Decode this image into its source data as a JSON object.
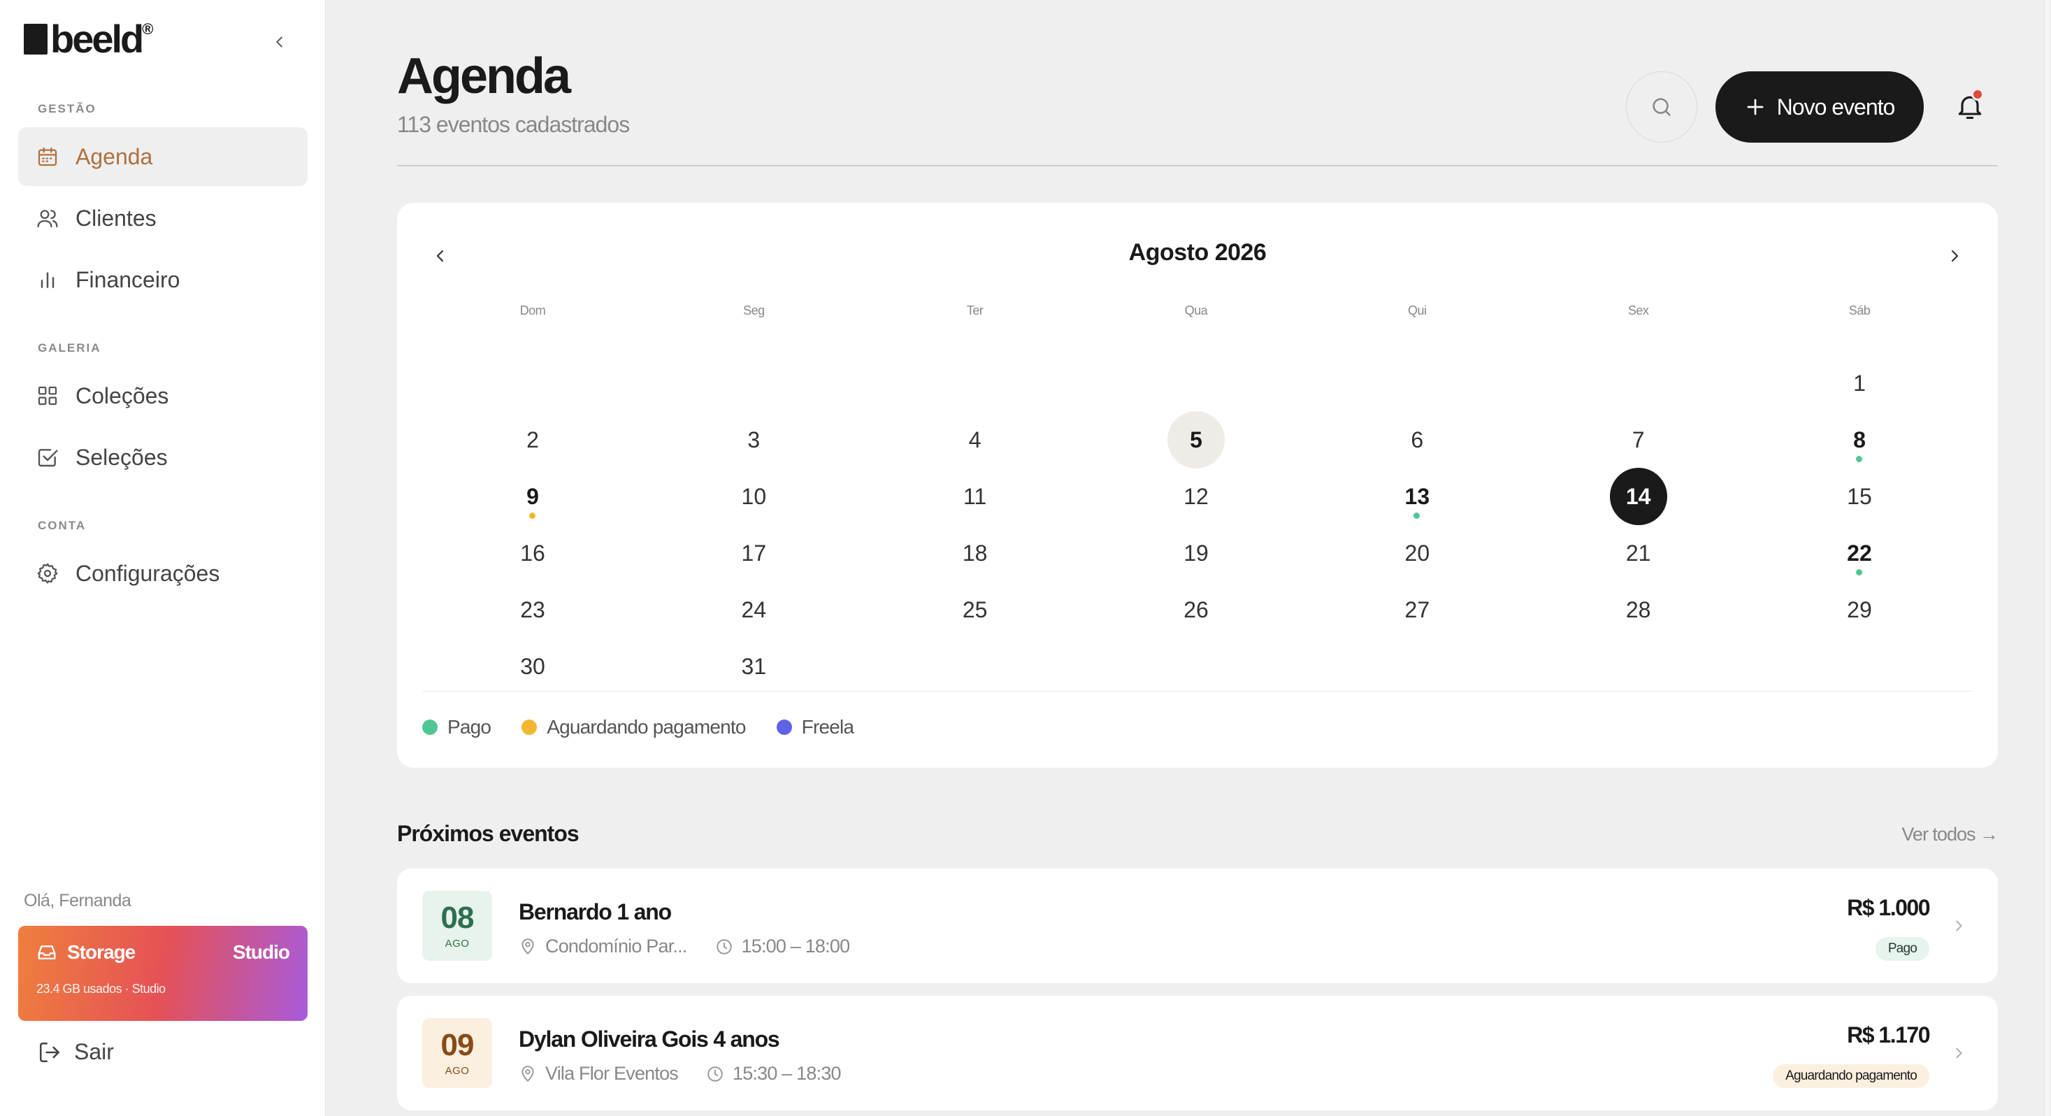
{
  "brand": {
    "name": "beeld",
    "reg": "®"
  },
  "sidebar": {
    "sections": [
      {
        "label": "GESTÃO"
      },
      {
        "label": "GALERIA"
      },
      {
        "label": "CONTA"
      }
    ],
    "items": [
      {
        "label": "Agenda",
        "icon": "calendar-icon",
        "active": true
      },
      {
        "label": "Clientes",
        "icon": "users-icon"
      },
      {
        "label": "Financeiro",
        "icon": "bar-chart-icon"
      },
      {
        "label": "Coleções",
        "icon": "grid-icon"
      },
      {
        "label": "Seleções",
        "icon": "check-square-icon"
      },
      {
        "label": "Configurações",
        "icon": "gear-icon"
      }
    ],
    "greeting": "Olá, Fernanda",
    "storage": {
      "label": "Storage",
      "plan": "Studio",
      "usage": "23.4 GB usados · Studio"
    },
    "logout_label": "Sair"
  },
  "header": {
    "title": "Agenda",
    "subtitle": "113 eventos cadastrados",
    "new_event_label": "Novo evento"
  },
  "calendar": {
    "month_label": "Agosto 2026",
    "weekdays": [
      "Dom",
      "Seg",
      "Ter",
      "Qua",
      "Qui",
      "Sex",
      "Sáb"
    ],
    "first_weekday_index": 6,
    "days_in_month": 31,
    "today": 14,
    "highlighted": 5,
    "event_days": [
      {
        "day": 8,
        "status": "Pago"
      },
      {
        "day": 9,
        "status": "Aguardando pagamento"
      },
      {
        "day": 13,
        "status": "Pago"
      },
      {
        "day": 22,
        "status": "Pago"
      }
    ],
    "legend": [
      {
        "label": "Pago",
        "color": "#4fc794"
      },
      {
        "label": "Aguardando pagamento",
        "color": "#f2b731"
      },
      {
        "label": "Freela",
        "color": "#5e62e6"
      }
    ]
  },
  "upcoming": {
    "title": "Próximos eventos",
    "see_all": "Ver todos →",
    "events": [
      {
        "day": "08",
        "month": "AGO",
        "name": "Bernardo 1 ano",
        "location": "Condomínio Par...",
        "time": "15:00 – 18:00",
        "price": "R$ 1.000",
        "status": "Pago",
        "date_bg": "#e6f4ec",
        "date_color": "#2f6e4f",
        "badge_bg": "#e6f4ec",
        "badge_color": "#1f3a2c"
      },
      {
        "day": "09",
        "month": "AGO",
        "name": "Dylan Oliveira Gois 4 anos",
        "location": "Vila Flor Eventos",
        "time": "15:30 – 18:30",
        "price": "R$ 1.170",
        "status": "Aguardando pagamento",
        "date_bg": "#fbf0e0",
        "date_color": "#8a4a15",
        "badge_bg": "#fbf0e0",
        "badge_color": "#1a1a1a"
      }
    ]
  }
}
